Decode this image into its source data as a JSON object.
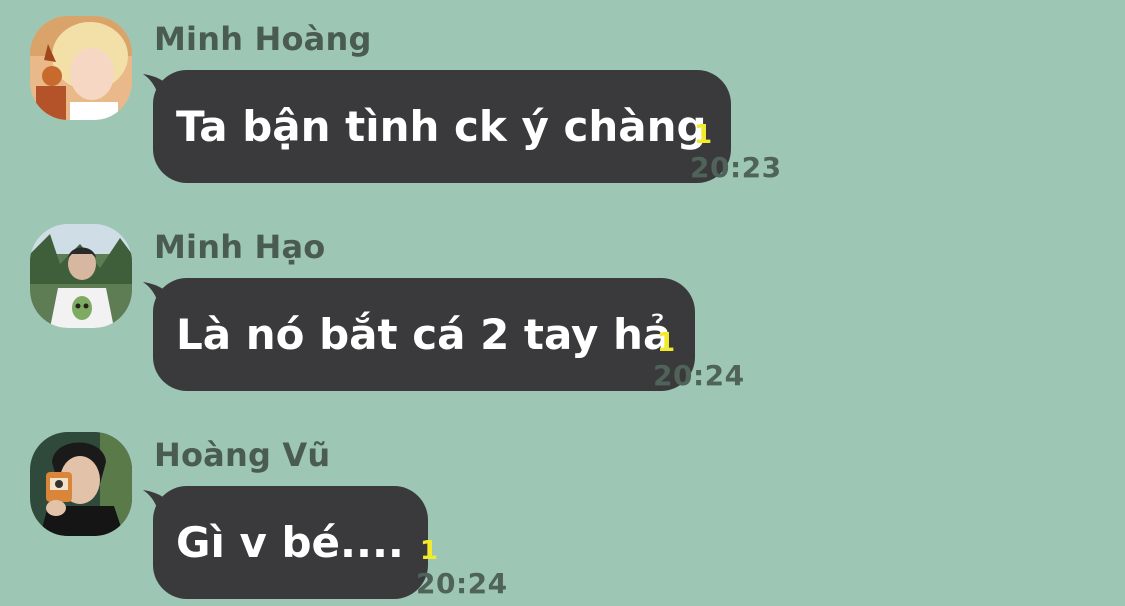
{
  "messages": [
    {
      "sender": "Minh Hoàng",
      "text": "Ta bận tình ck ý chàng",
      "unread": "1",
      "time": "20:23",
      "avatar": "avatar-blonde-person-icon"
    },
    {
      "sender": "Minh Hạo",
      "text": "Là nó bắt cá 2 tay hả",
      "unread": "1",
      "time": "20:24",
      "avatar": "avatar-person-alien-shirt-icon"
    },
    {
      "sender": "Hoàng Vũ",
      "text": "Gì v bé....",
      "unread": "1",
      "time": "20:24",
      "avatar": "avatar-person-camera-icon"
    }
  ],
  "colors": {
    "background": "#9dc7b4",
    "bubble": "#3a3a3c",
    "unread": "#f2ea2c",
    "time": "#4f6358",
    "sender": "#4a5c52"
  }
}
